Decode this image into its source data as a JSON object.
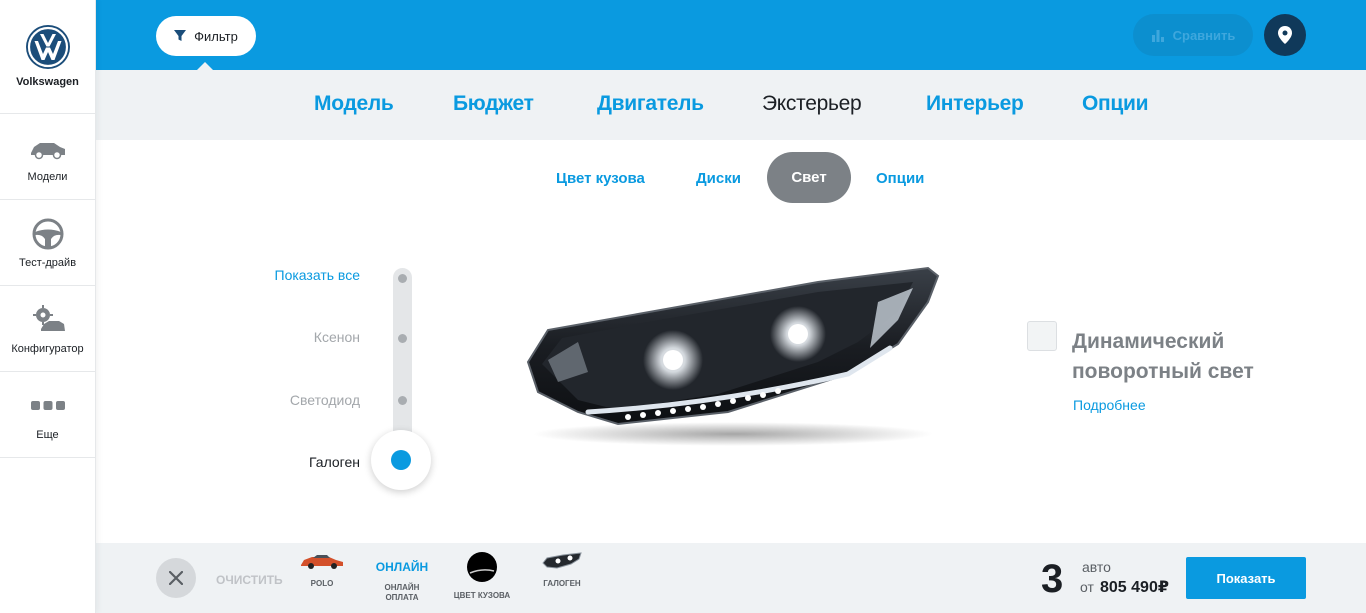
{
  "brand": {
    "name": "Volkswagen"
  },
  "sidebar": {
    "items": [
      {
        "label": "Модели",
        "icon": "car-icon"
      },
      {
        "label": "Тест-драйв",
        "icon": "steering-wheel-icon"
      },
      {
        "label": "Конфигуратор",
        "icon": "configurator-icon"
      },
      {
        "label": "Еще",
        "icon": "more-dots-icon"
      }
    ]
  },
  "topbar": {
    "filter_label": "Фильтр",
    "compare_label": "Сравнить"
  },
  "main_tabs": [
    {
      "label": "Модель",
      "active": false
    },
    {
      "label": "Бюджет",
      "active": false
    },
    {
      "label": "Двигатель",
      "active": false
    },
    {
      "label": "Экстерьер",
      "active": true
    },
    {
      "label": "Интерьер",
      "active": false
    },
    {
      "label": "Опции",
      "active": false
    }
  ],
  "sub_tabs": [
    {
      "label": "Цвет кузова",
      "active": false
    },
    {
      "label": "Диски",
      "active": false
    },
    {
      "label": "Свет",
      "active": true
    },
    {
      "label": "Опции",
      "active": false
    }
  ],
  "light_selector": {
    "show_all": "Показать все",
    "options": [
      "Ксенон",
      "Светодиод",
      "Галоген"
    ],
    "selected": "Галоген"
  },
  "feature": {
    "title": "Динамический поворотный свет",
    "link": "Подробнее",
    "checked": false
  },
  "bottom": {
    "clear_label": "ОЧИСТИТЬ",
    "chips": [
      {
        "label": "POLO",
        "type": "car"
      },
      {
        "top": "ОНЛАЙН",
        "label": "ОНЛАЙН ОПЛАТА",
        "type": "text"
      },
      {
        "label": "ЦВЕТ КУЗОВА",
        "type": "color",
        "color": "#000000"
      },
      {
        "label": "ГАЛОГЕН",
        "type": "headlight"
      }
    ],
    "count": "3",
    "count_unit": "авто",
    "price_prefix": "от",
    "price": "805 490₽",
    "show_label": "Показать"
  },
  "colors": {
    "accent": "#0a9ae0",
    "active_pill": "#7c8186",
    "location_button": "#10395a"
  }
}
